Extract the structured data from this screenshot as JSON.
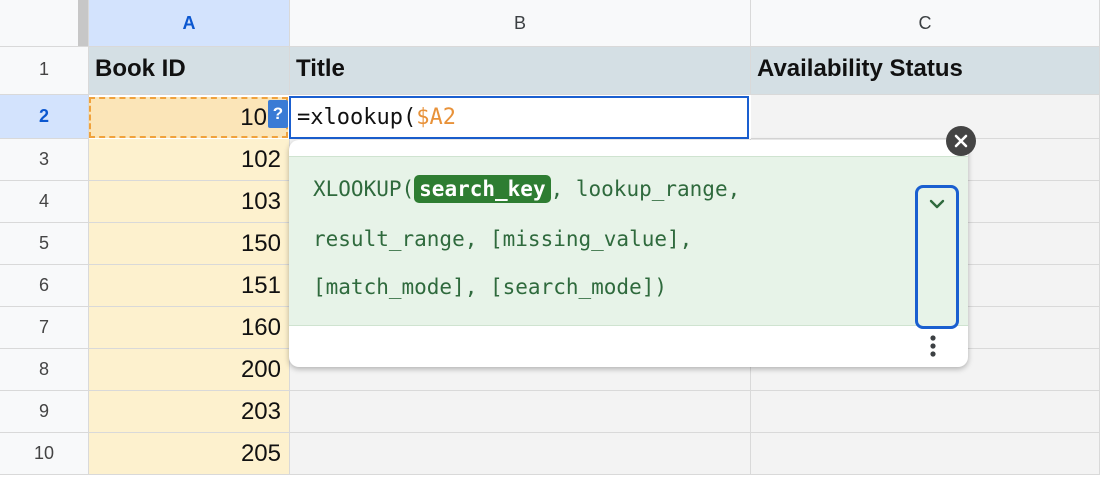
{
  "columns": [
    {
      "id": "A",
      "label": "A",
      "selected": true
    },
    {
      "id": "B",
      "label": "B",
      "selected": false
    },
    {
      "id": "C",
      "label": "C",
      "selected": false
    }
  ],
  "rows": [
    {
      "num": "1",
      "a": "Book ID",
      "b": "Title",
      "c": "Availability Status"
    },
    {
      "num": "2",
      "a": "10",
      "b": "",
      "c": ""
    },
    {
      "num": "3",
      "a": "102",
      "b": "",
      "c": ""
    },
    {
      "num": "4",
      "a": "103",
      "b": "",
      "c": ""
    },
    {
      "num": "5",
      "a": "150",
      "b": "",
      "c": ""
    },
    {
      "num": "6",
      "a": "151",
      "b": "",
      "c": ""
    },
    {
      "num": "7",
      "a": "160",
      "b": "",
      "c": ""
    },
    {
      "num": "8",
      "a": "200",
      "b": "",
      "c": ""
    },
    {
      "num": "9",
      "a": "203",
      "b": "",
      "c": ""
    },
    {
      "num": "10",
      "a": "205",
      "b": "",
      "c": ""
    }
  ],
  "selected_row": "2",
  "help_button_label": "?",
  "editor": {
    "formula_prefix": "=xlookup(",
    "formula_ref": "$A2"
  },
  "formula_help": {
    "function_name": "XLOOKUP(",
    "active_arg": "search_key",
    "line1_rest": ", lookup_range,",
    "line2": "result_range, [missing_value],",
    "line3": "[match_mode], [search_mode])"
  },
  "icons": {
    "close": "close-icon",
    "expand": "chevron-down-icon",
    "more": "more-vert-icon"
  },
  "colors": {
    "header_row_bg": "#d4dfe4",
    "column_a_bg": "#fdf1ce",
    "editor_border": "#1a5fd0",
    "ref_color": "#e8923a",
    "help_bg": "#e7f3e8",
    "active_arg_bg": "#2e7d32"
  }
}
